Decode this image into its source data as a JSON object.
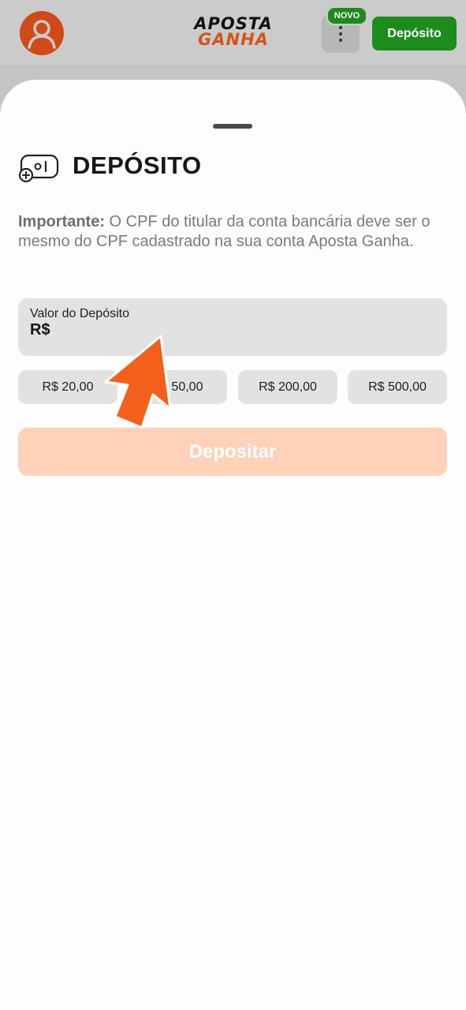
{
  "header": {
    "logo_line1": "APOSTA",
    "logo_line2": "GANHA",
    "badge": "NOVO",
    "deposit_button": "Depósito"
  },
  "sheet": {
    "title": "DEPÓSITO",
    "notice_bold": "Importante:",
    "notice_text": " O CPF do titular da conta bancária deve ser o mesmo do CPF cadastrado na sua conta Aposta Ganha.",
    "input_label": "Valor do Depósito",
    "input_prefix": "R$",
    "amounts": [
      "R$ 20,00",
      "R$ 50,00",
      "R$ 200,00",
      "R$ 500,00"
    ],
    "submit_label": "Depositar"
  },
  "colors": {
    "brand_orange": "#d4551a",
    "brand_green": "#1c8c1c",
    "submit_disabled": "#fdd2b8",
    "pointer_arrow": "#f2601c"
  },
  "icons": {
    "avatar": "user-avatar-icon",
    "menu": "more-vertical-icon",
    "title": "gamepad-plus-icon",
    "pointer": "pointer-arrow-icon"
  }
}
